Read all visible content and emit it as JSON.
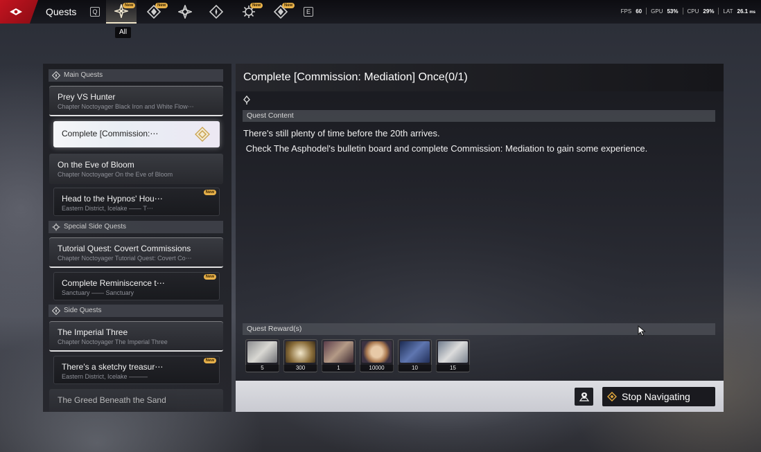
{
  "topbar": {
    "title": "Quests",
    "key_prev": "Q",
    "key_next": "E",
    "tabs": [
      {
        "icon": "flower-star-icon",
        "new": "New",
        "active": true
      },
      {
        "icon": "diamond-arrow-icon",
        "new": "New",
        "active": false
      },
      {
        "icon": "shuriken-icon",
        "new": "",
        "active": false
      },
      {
        "icon": "compass-diamond-icon",
        "new": "",
        "active": false
      },
      {
        "icon": "gear-star-icon",
        "new": "New",
        "active": false
      },
      {
        "icon": "diamond-arrow-icon",
        "new": "New",
        "active": false
      }
    ],
    "active_tab_tooltip": "All",
    "stats": {
      "fps_label": "FPS",
      "fps": "60",
      "gpu_label": "GPU",
      "gpu": "53",
      "cpu_label": "CPU",
      "cpu": "29",
      "lat_label": "LAT",
      "lat": "26.1",
      "pct": "%",
      "ms": "ms"
    }
  },
  "quest_list": {
    "sections": [
      {
        "label": "Main Quests",
        "icon": "compass-diamond-icon"
      },
      {
        "label": "Special Side Quests",
        "icon": "gear-star-icon"
      },
      {
        "label": "Side Quests",
        "icon": "compass-diamond-icon"
      }
    ],
    "items": [
      {
        "name": "Prey VS Hunter",
        "sub": "Chapter Noctoyager Black Iron and White Flow⋯"
      },
      {
        "name": "Complete [Commission:⋯",
        "sub": ""
      },
      {
        "name": "On the Eve of Bloom",
        "sub": "Chapter Noctoyager On the Eve of Bloom"
      },
      {
        "name": "Head to the Hypnos' Hou⋯",
        "sub": "Eastern District, Icelake —— T⋯",
        "new": "New"
      },
      {
        "name": "Tutorial Quest: Covert Commissions",
        "sub": "Chapter Noctoyager Tutorial Quest: Covert Co⋯"
      },
      {
        "name": "Complete Reminiscence t⋯",
        "sub": "Sanctuary —— Sanctuary",
        "new": "New"
      },
      {
        "name": "The Imperial Three",
        "sub": "Chapter Noctoyager The Imperial Three"
      },
      {
        "name": "There's a sketchy treasur⋯",
        "sub": "Eastern District, Icelake ———",
        "new": "New"
      },
      {
        "name": "The Greed Beneath the Sand",
        "sub": ""
      }
    ]
  },
  "detail": {
    "title": "Complete [Commission: Mediation] Once(0/1)",
    "content_label": "Quest Content",
    "description": "There's still plenty of time before the 20th arrives.\n Check The Asphodel's bulletin board and complete Commission: Mediation to gain some experience.",
    "reward_label": "Quest Reward(s)",
    "rewards": [
      {
        "icon": "tool-kit-icon",
        "count": "5"
      },
      {
        "icon": "antler-emblem-icon",
        "count": "300"
      },
      {
        "icon": "diamond-core-icon",
        "count": "1"
      },
      {
        "icon": "coin-icon",
        "count": "10000"
      },
      {
        "icon": "blue-tome-icon",
        "count": "10"
      },
      {
        "icon": "document-stack-icon",
        "count": "15"
      }
    ],
    "map_button_icon": "map-pin-icon",
    "navigate_label": "Stop Navigating"
  },
  "colors": {
    "brand_red": "#c41420",
    "new_badge": "#e7b14a",
    "accent_gold": "#e0a63c"
  }
}
